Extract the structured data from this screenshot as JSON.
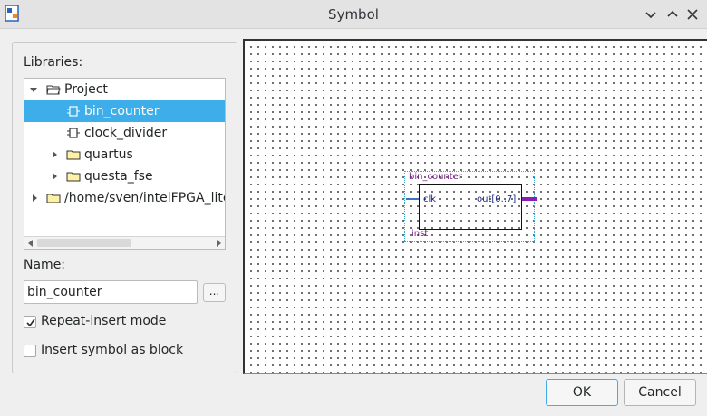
{
  "window": {
    "title": "Symbol"
  },
  "libraries": {
    "label": "Libraries:",
    "tree": [
      {
        "label": "Project",
        "type": "folder-open",
        "expanded": true,
        "level": 0,
        "selected": false
      },
      {
        "label": "bin_counter",
        "type": "symbol",
        "level": 1,
        "selected": true
      },
      {
        "label": "clock_divider",
        "type": "symbol",
        "level": 1,
        "selected": false
      },
      {
        "label": "quartus",
        "type": "folder",
        "expanded": false,
        "level": 1,
        "selected": false
      },
      {
        "label": "questa_fse",
        "type": "folder",
        "expanded": false,
        "level": 1,
        "selected": false
      },
      {
        "label": "/home/sven/intelFPGA_lite",
        "type": "folder",
        "expanded": false,
        "level": 0,
        "selected": false
      }
    ]
  },
  "name": {
    "label": "Name:",
    "value": "bin_counter",
    "browse_label": "..."
  },
  "options": {
    "repeat_insert": {
      "label": "Repeat-insert mode",
      "checked": true
    },
    "insert_as_block": {
      "label": "Insert symbol as block",
      "checked": false
    }
  },
  "preview": {
    "symbol_name": "bin_counter",
    "instance_name": "inst",
    "input_pin": "clk",
    "output_pin": "out[0..7]"
  },
  "buttons": {
    "ok": "OK",
    "cancel": "Cancel"
  },
  "colors": {
    "selection": "#3daee9",
    "symbol_label": "#7a1f8a",
    "pin_label": "#1d2a8a",
    "output_bus": "#8a1fb4"
  }
}
